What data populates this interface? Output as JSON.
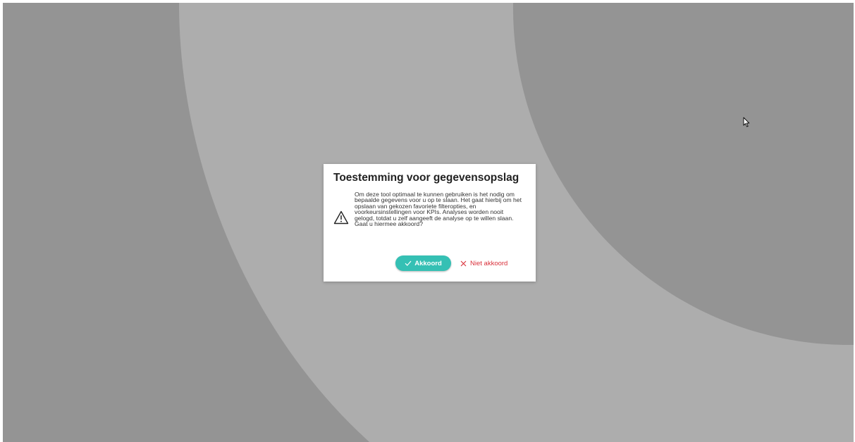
{
  "dialog": {
    "title": "Toestemming voor gegevensopslag",
    "message": "Om deze tool optimaal te kunnen gebruiken is het nodig om bepaalde gegevens voor u op te slaan. Het gaat hierbij om het opslaan van gekozen favoriete filteropties, en voorkeursinstellingen voor KPIs. Analyses worden nooit gelogd, totdat u zelf aangeeft de analyse op te willen slaan. Gaat u hiermee akkoord?",
    "icon": "warning-icon",
    "accept_label": "Akkoord",
    "accept_icon": "check-icon",
    "decline_label": "Niet akkoord",
    "decline_icon": "close-icon"
  },
  "colors": {
    "background_dark": "#949494",
    "background_light": "#adadad",
    "accept_button": "#35c0b4",
    "decline_text": "#d9303a"
  }
}
